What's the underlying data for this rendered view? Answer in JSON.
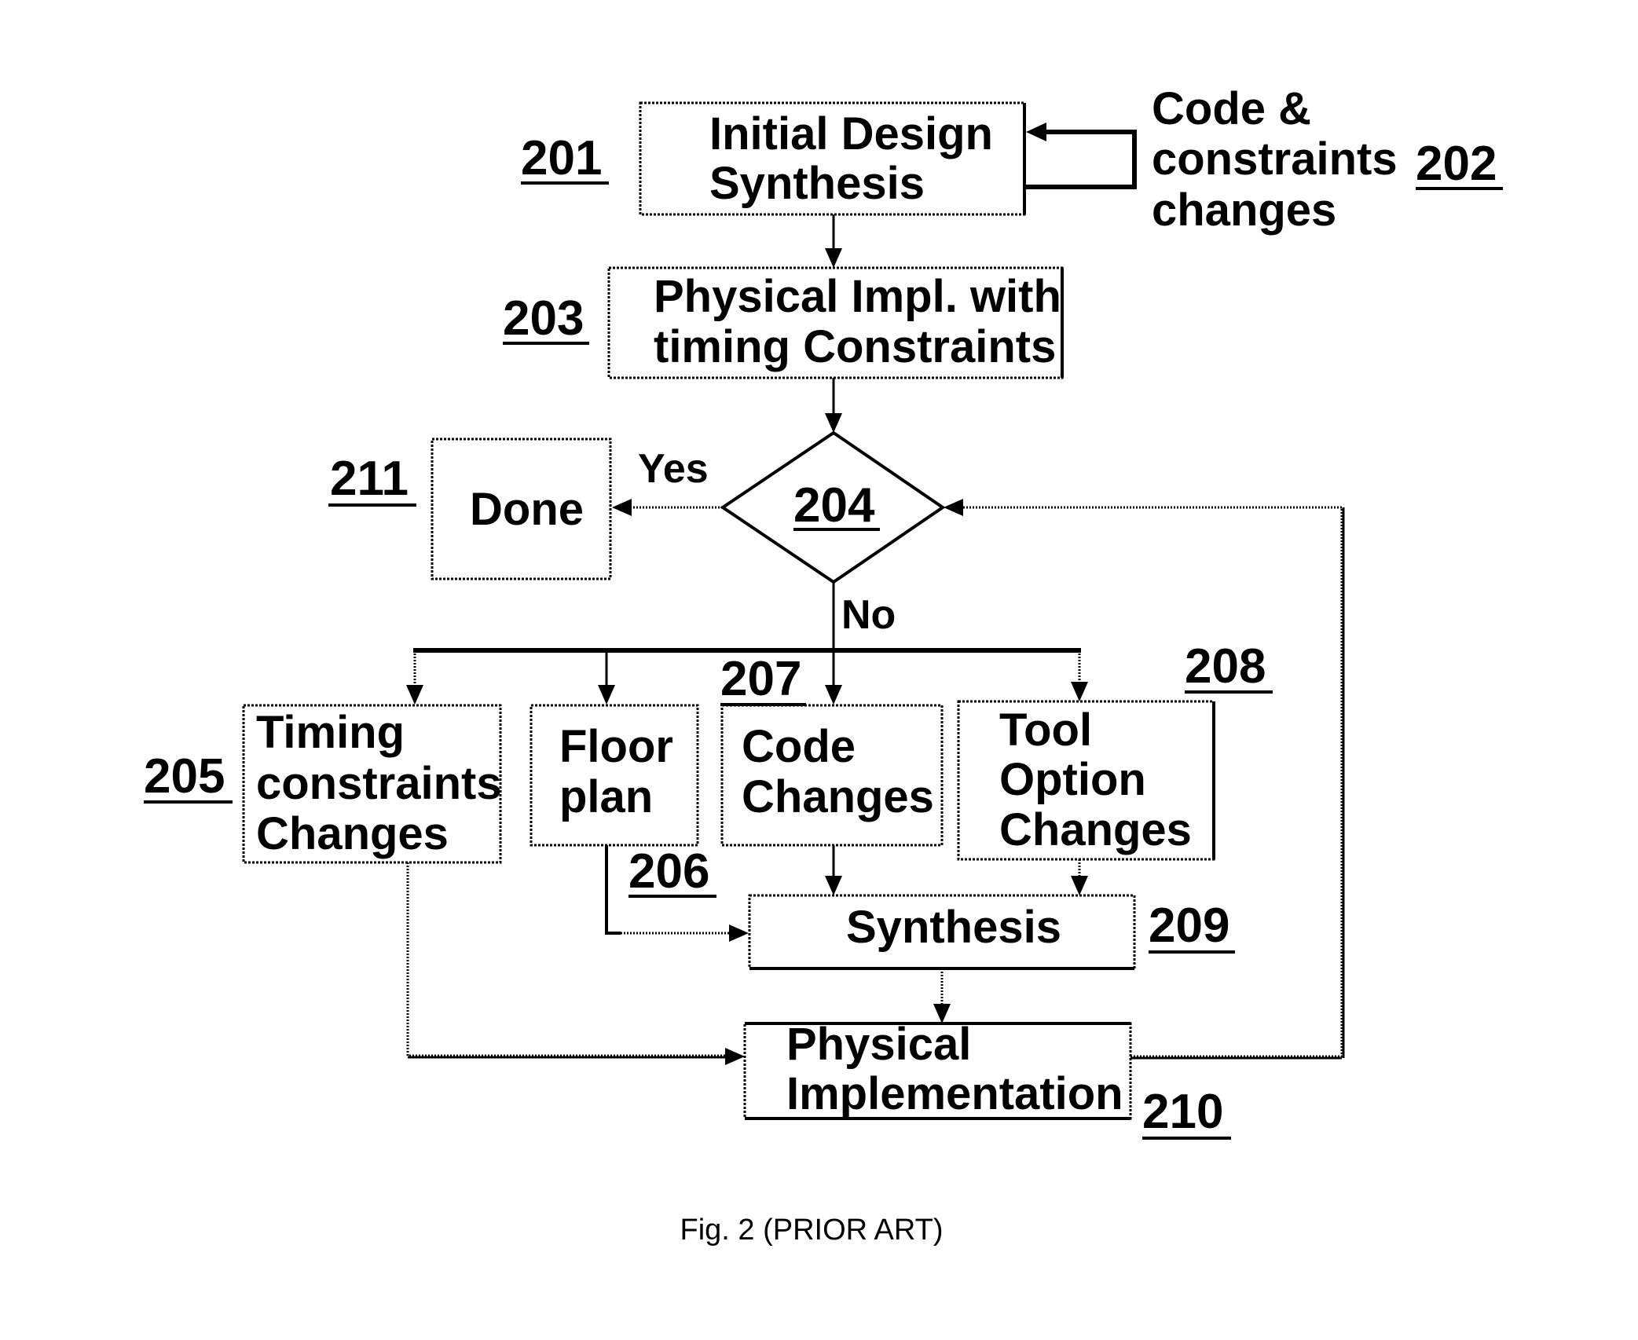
{
  "figure": {
    "caption": "Fig. 2 (PRIOR ART)",
    "nodes": {
      "n201": {
        "ref": "201",
        "lines": [
          "Initial Design",
          "Synthesis"
        ],
        "shape": "box"
      },
      "n202": {
        "ref": "202",
        "lines": [
          "Code &",
          "constraints",
          "changes"
        ],
        "shape": "annotation"
      },
      "n203": {
        "ref": "203",
        "lines": [
          "Physical Impl. with",
          "timing Constraints"
        ],
        "shape": "box"
      },
      "n204": {
        "ref": "204",
        "shape": "decision"
      },
      "n205": {
        "ref": "205",
        "lines": [
          "Timing",
          "constraints",
          "Changes"
        ],
        "shape": "box"
      },
      "n206": {
        "ref": "206",
        "lines": [
          "Floor",
          "plan"
        ],
        "shape": "box"
      },
      "n207": {
        "ref": "207",
        "lines": [
          "Code",
          "Changes"
        ],
        "shape": "box"
      },
      "n208": {
        "ref": "208",
        "lines": [
          "Tool",
          "Option",
          "Changes"
        ],
        "shape": "box"
      },
      "n209": {
        "ref": "209",
        "lines": [
          "Synthesis"
        ],
        "shape": "box"
      },
      "n210": {
        "ref": "210",
        "lines": [
          "Physical",
          "Implementation"
        ],
        "shape": "box"
      },
      "n211": {
        "ref": "211",
        "lines": [
          "Done"
        ],
        "shape": "box"
      }
    },
    "edges": [
      {
        "from": "202",
        "to": "201",
        "label": ""
      },
      {
        "from": "201",
        "to": "203",
        "label": ""
      },
      {
        "from": "203",
        "to": "204",
        "label": ""
      },
      {
        "from": "204",
        "to": "211",
        "label": "Yes"
      },
      {
        "from": "204",
        "to": "205",
        "label": "No"
      },
      {
        "from": "204",
        "to": "206",
        "label": "No"
      },
      {
        "from": "204",
        "to": "207",
        "label": "No"
      },
      {
        "from": "204",
        "to": "208",
        "label": "No"
      },
      {
        "from": "206",
        "to": "209",
        "label": ""
      },
      {
        "from": "207",
        "to": "209",
        "label": ""
      },
      {
        "from": "208",
        "to": "209",
        "label": ""
      },
      {
        "from": "209",
        "to": "210",
        "label": ""
      },
      {
        "from": "205",
        "to": "210",
        "label": ""
      },
      {
        "from": "210",
        "to": "204",
        "label": ""
      }
    ],
    "edge_labels": {
      "yes": "Yes",
      "no": "No"
    }
  }
}
